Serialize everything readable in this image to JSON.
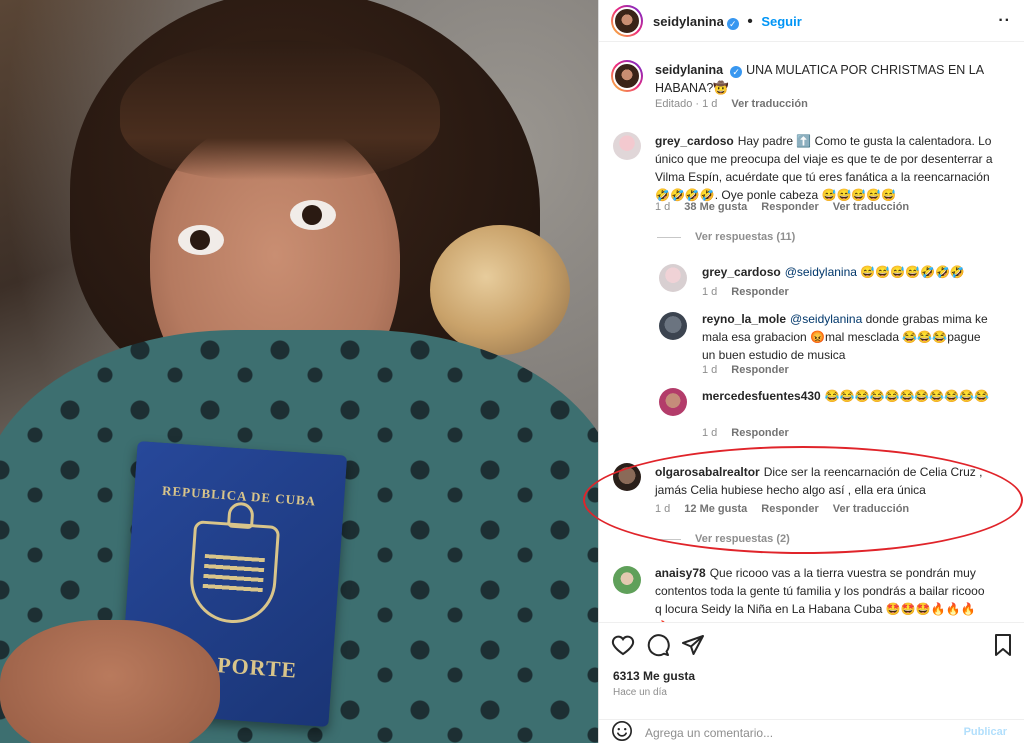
{
  "photo": {
    "passport_country": "REPUBLICA DE CUBA",
    "passport_title": "PASAPORTE"
  },
  "header": {
    "username": "seidylanina",
    "follow_label": "Seguir",
    "more_icon": "more-horizontal-icon"
  },
  "caption": {
    "username": "seidylanina",
    "text": "UNA MULATICA POR CHRISTMAS EN LA HABANA?🤠",
    "edited": "Editado · 1 d",
    "see_translation": "Ver traducción"
  },
  "comments": [
    {
      "username": "grey_cardoso",
      "text": "Hay padre ⬆️ Como te gusta la calentadora. Lo único que me preocupa del viaje es que te de por desenterrar a Vilma Espín, acuérdate que tú eres fanática a la reencarnación 🤣🤣🤣🤣. Oye ponle cabeza 😅😅😅😅😅",
      "time": "1 d",
      "likes": "38 Me gusta",
      "reply": "Responder",
      "translate": "Ver traducción",
      "view_replies": "Ver respuestas (11)"
    },
    {
      "username": "olgarosabalrealtor",
      "text": "Dice ser la reencarnación de Celia Cruz , jamás Celia hubiese hecho algo así , ella era única",
      "time": "1 d",
      "likes": "12 Me gusta",
      "reply": "Responder",
      "translate": "Ver traducción",
      "view_replies": "Ver respuestas (2)"
    },
    {
      "username": "anaisy78",
      "text": "Que ricooo vas a la tierra vuestra se pondrán muy contentos toda la gente tú familia y los pondrás a bailar ricooo q locura Seidy la Niña en La Habana Cuba 🤩🤩🤩🔥🔥🔥🔥"
    }
  ],
  "replies": [
    {
      "username": "grey_cardoso",
      "mention": "@seidylanina",
      "text": " 😅😅😅😅🤣🤣🤣",
      "time": "1 d",
      "reply": "Responder"
    },
    {
      "username": "reyno_la_mole",
      "mention": "@seidylanina",
      "text": " donde grabas mima ke mala esa grabacion 😡mal mesclada 😂😂😂pague un buen estudio de musica",
      "time": "1 d",
      "reply": "Responder"
    },
    {
      "username": "mercedesfuentes430",
      "mention": "",
      "text": "😂😂😂😂😂😂😂😂😂😂😂",
      "time": "1 d",
      "reply": "Responder"
    }
  ],
  "actions": {
    "like_icon": "heart-icon",
    "comment_icon": "comment-icon",
    "share_icon": "send-icon",
    "save_icon": "bookmark-icon",
    "likes_count": "6313 Me gusta",
    "time_ago": "Hace un día"
  },
  "add_comment": {
    "placeholder": "Agrega un comentario...",
    "publish_label": "Publicar",
    "emoji_icon": "emoji-icon"
  },
  "colors": {
    "link_blue": "#0095f6",
    "highlight_red": "#e0242a",
    "muted_gray": "#8e8e8e"
  }
}
